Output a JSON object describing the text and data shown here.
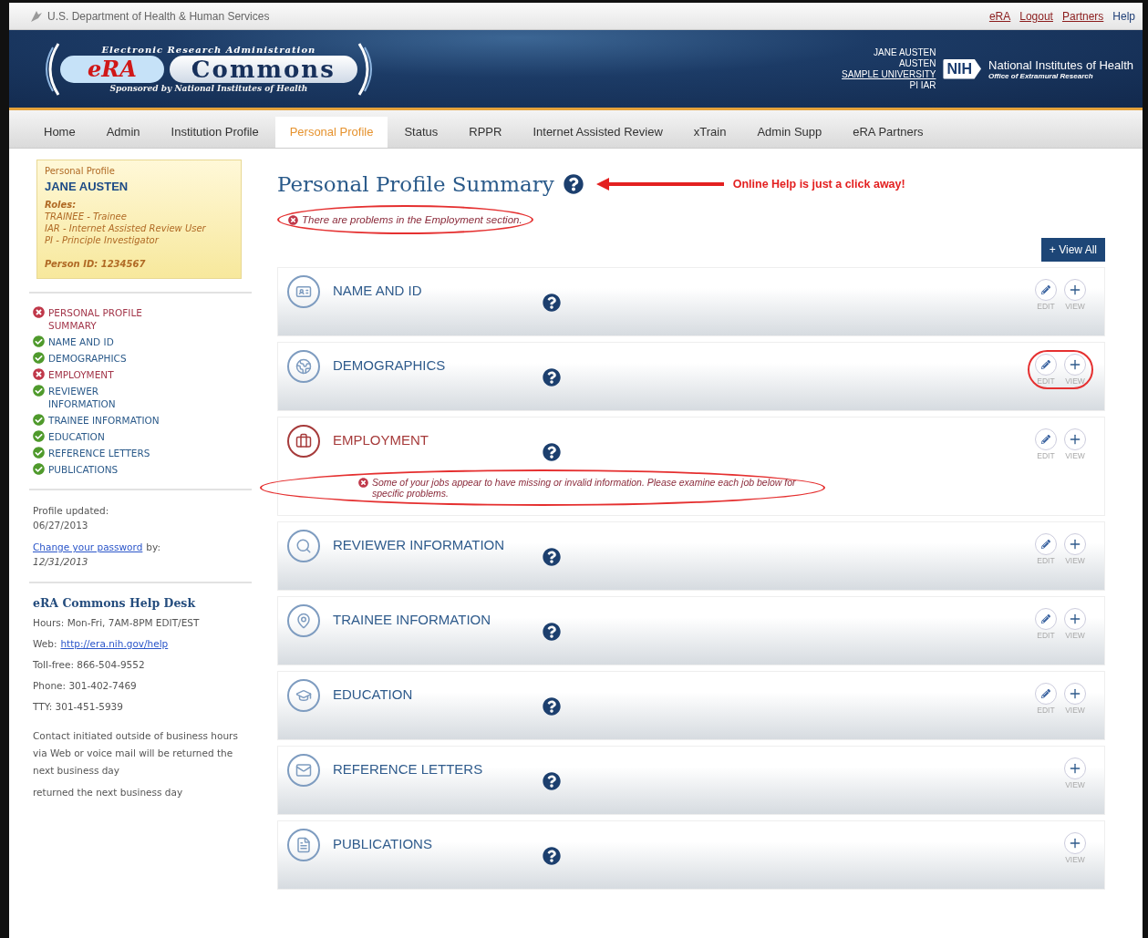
{
  "gov_bar": {
    "agency": "U.S. Department of Health & Human Services",
    "links": [
      {
        "label": "eRA",
        "kind": "link"
      },
      {
        "label": "Logout",
        "kind": "link"
      },
      {
        "label": "Partners",
        "kind": "link"
      },
      {
        "label": "Help",
        "kind": "plain"
      }
    ]
  },
  "banner": {
    "logo": {
      "tagline": "Electronic Research Administration",
      "mark": "eRA",
      "name": "Commons",
      "sponsor": "Sponsored by National Institutes of Health"
    },
    "user": {
      "name": "JANE AUSTEN",
      "surname": "AUSTEN",
      "institution": "SAMPLE UNIVERSITY",
      "roles": "PI IAR"
    },
    "nih": {
      "mark": "NIH",
      "name": "National Institutes of Health",
      "office": "Office of Extramural Research"
    }
  },
  "tabs": [
    {
      "label": "Home",
      "selected": false
    },
    {
      "label": "Admin",
      "selected": false
    },
    {
      "label": "Institution Profile",
      "selected": false
    },
    {
      "label": "Personal Profile",
      "selected": true
    },
    {
      "label": "Status",
      "selected": false
    },
    {
      "label": "RPPR",
      "selected": false
    },
    {
      "label": "Internet Assisted Review",
      "selected": false
    },
    {
      "label": "xTrain",
      "selected": false
    },
    {
      "label": "Admin Supp",
      "selected": false
    },
    {
      "label": "eRA Partners",
      "selected": false
    }
  ],
  "sidebar": {
    "card": {
      "heading": "Personal Profile",
      "name": "JANE AUSTEN",
      "roles_label": "Roles:",
      "roles": [
        "TRAINEE - Trainee",
        "IAR - Internet Assisted Review User",
        "PI - Principle Investigator"
      ],
      "person_id": "Person ID: 1234567"
    },
    "nav": [
      {
        "label": "PERSONAL PROFILE SUMMARY",
        "problem": true
      },
      {
        "label": "NAME AND ID",
        "problem": false
      },
      {
        "label": "DEMOGRAPHICS",
        "problem": false
      },
      {
        "label": "EMPLOYMENT",
        "problem": true
      },
      {
        "label": "REVIEWER INFORMATION",
        "problem": false
      },
      {
        "label": "TRAINEE INFORMATION",
        "problem": false
      },
      {
        "label": "EDUCATION",
        "problem": false
      },
      {
        "label": "REFERENCE LETTERS",
        "problem": false
      },
      {
        "label": "PUBLICATIONS",
        "problem": false
      }
    ],
    "profile_updated": {
      "label": "Profile updated:",
      "date": "06/27/2013"
    },
    "password": {
      "link": "Change your password",
      "suffix": "by:",
      "date": "12/31/2013"
    },
    "help_desk": {
      "title": "eRA Commons Help Desk",
      "lines": [
        {
          "label": "Hours: Mon-Fri, 7AM-8PM EDIT/EST"
        },
        {
          "label": "Web:",
          "link": "http://era.nih.gov/help"
        },
        {
          "label": "Toll-free: 866-504-9552"
        },
        {
          "label": "Phone: 301-402-7469"
        },
        {
          "label": "TTY: 301-451-5939"
        }
      ],
      "note": "Contact initiated outside of business hours via Web or voice mail will be returned the next business day",
      "note_repeat": "returned the next business day"
    }
  },
  "main": {
    "title": "Personal Profile Summary",
    "annotation": "Online Help is just a click away!",
    "summary_error": {
      "text": "There are problems in the Employment section.",
      "circled": true
    },
    "view_all": "+ View All",
    "sections": [
      {
        "title": "NAME AND ID",
        "problem": false,
        "circled": false,
        "actions": [
          {
            "kind": "edit",
            "label": "EDIT"
          },
          {
            "kind": "view",
            "label": "VIEW"
          }
        ]
      },
      {
        "title": "DEMOGRAPHICS",
        "problem": false,
        "circled": true,
        "actions": [
          {
            "kind": "edit",
            "label": "EDIT"
          },
          {
            "kind": "view",
            "label": "VIEW"
          }
        ]
      },
      {
        "title": "EMPLOYMENT",
        "problem": true,
        "circled": false,
        "actions": [
          {
            "kind": "edit",
            "label": "EDIT"
          },
          {
            "kind": "view",
            "label": "VIEW"
          }
        ],
        "error": {
          "text": "Some of your jobs appear to have missing or invalid information. Please examine each job below for specific problems.",
          "circled": true
        }
      },
      {
        "title": "REVIEWER INFORMATION",
        "problem": false,
        "circled": false,
        "actions": [
          {
            "kind": "edit",
            "label": "EDIT"
          },
          {
            "kind": "view",
            "label": "VIEW"
          }
        ]
      },
      {
        "title": "TRAINEE INFORMATION",
        "problem": false,
        "circled": false,
        "actions": [
          {
            "kind": "edit",
            "label": "EDIT"
          },
          {
            "kind": "view",
            "label": "VIEW"
          }
        ]
      },
      {
        "title": "EDUCATION",
        "problem": false,
        "circled": false,
        "actions": [
          {
            "kind": "edit",
            "label": "EDIT"
          },
          {
            "kind": "view",
            "label": "VIEW"
          }
        ]
      },
      {
        "title": "REFERENCE LETTERS",
        "problem": false,
        "circled": false,
        "actions": [
          {
            "kind": "view",
            "label": "VIEW"
          }
        ]
      },
      {
        "title": "PUBLICATIONS",
        "problem": false,
        "circled": false,
        "actions": [
          {
            "kind": "view",
            "label": "VIEW"
          }
        ]
      }
    ]
  }
}
